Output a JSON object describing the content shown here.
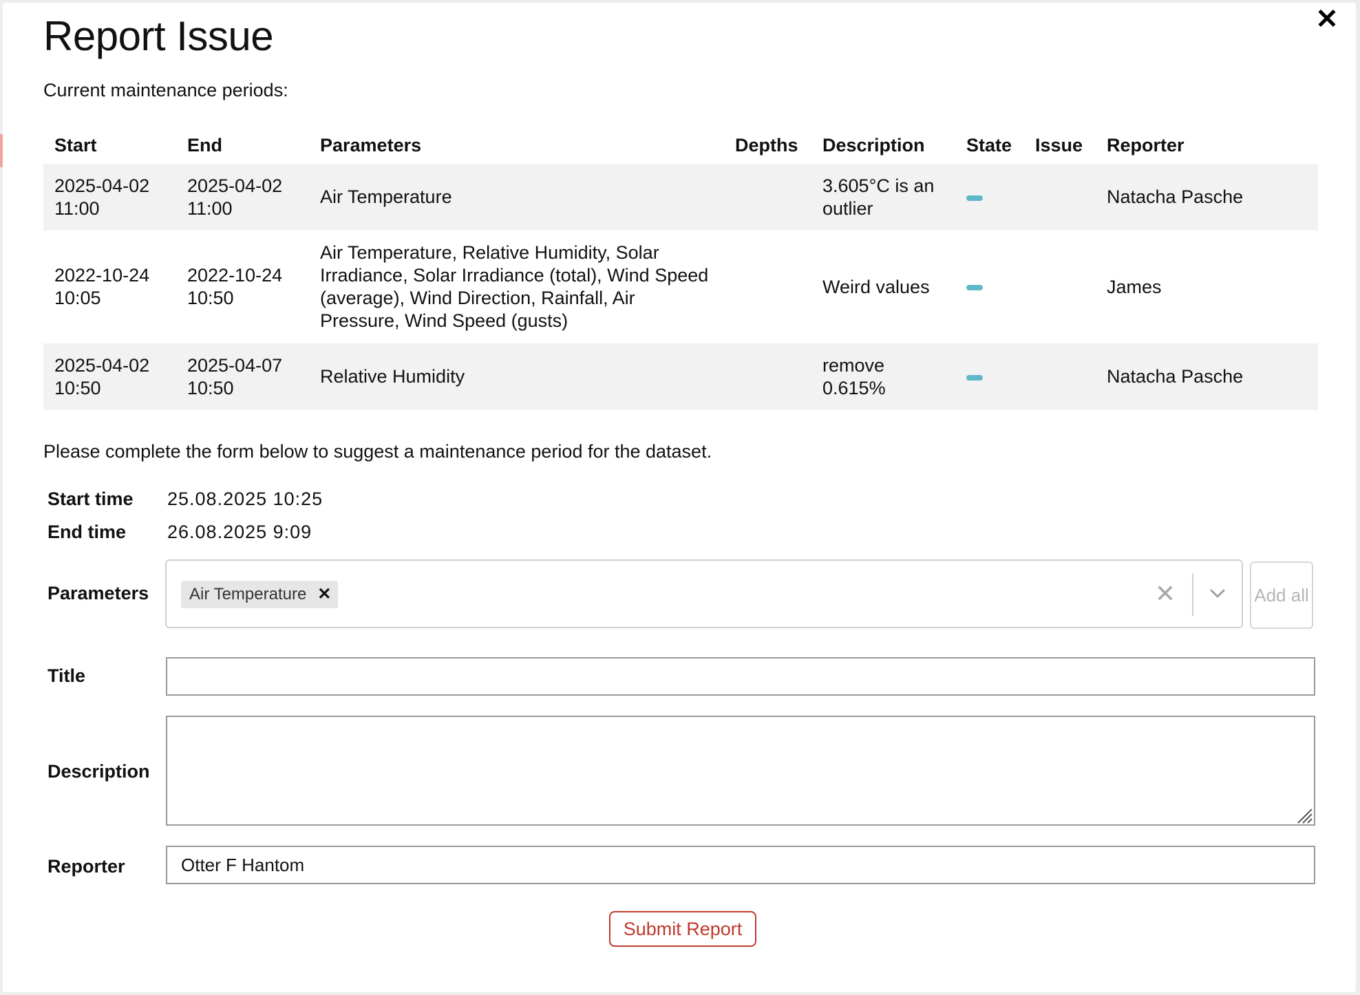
{
  "modal": {
    "title": "Report Issue",
    "close_icon": "close-icon",
    "periods_heading": "Current maintenance periods:",
    "table": {
      "headers": {
        "start": "Start",
        "end": "End",
        "parameters": "Parameters",
        "depths": "Depths",
        "description": "Description",
        "state": "State",
        "issue": "Issue",
        "reporter": "Reporter"
      },
      "rows": [
        {
          "start": "2025-04-02 11:00",
          "end": "2025-04-02 11:00",
          "parameters": "Air Temperature",
          "depths": "",
          "description": "3.605°C is an outlier",
          "issue": "",
          "reporter": "Natacha Pasche"
        },
        {
          "start": "2022-10-24 10:05",
          "end": "2022-10-24 10:50",
          "parameters": "Air Temperature, Relative Humidity, Solar Irradiance, Solar Irradiance (total), Wind Speed (average), Wind Direction, Rainfall, Air Pressure, Wind Speed (gusts)",
          "depths": "",
          "description": "Weird values",
          "issue": "",
          "reporter": "James"
        },
        {
          "start": "2025-04-02 10:50",
          "end": "2025-04-07 10:50",
          "parameters": "Relative Humidity",
          "depths": "",
          "description": "remove 0.615%",
          "issue": "",
          "reporter": "Natacha Pasche"
        }
      ],
      "state_color": "#5fb8c6"
    },
    "instructions": "Please complete the form below to suggest a maintenance period for the dataset.",
    "form": {
      "start_label": "Start time",
      "start_value": "25.08.2025 10:25",
      "end_label": "End time",
      "end_value": "26.08.2025 9:09",
      "parameters_label": "Parameters",
      "selected_parameters": [
        "Air Temperature"
      ],
      "add_all_label": "Add all",
      "title_label": "Title",
      "title_value": "",
      "description_label": "Description",
      "description_value": "",
      "reporter_label": "Reporter",
      "reporter_value": "Otter F Hantom",
      "submit_label": "Submit Report",
      "submit_color": "#c0392b"
    }
  }
}
